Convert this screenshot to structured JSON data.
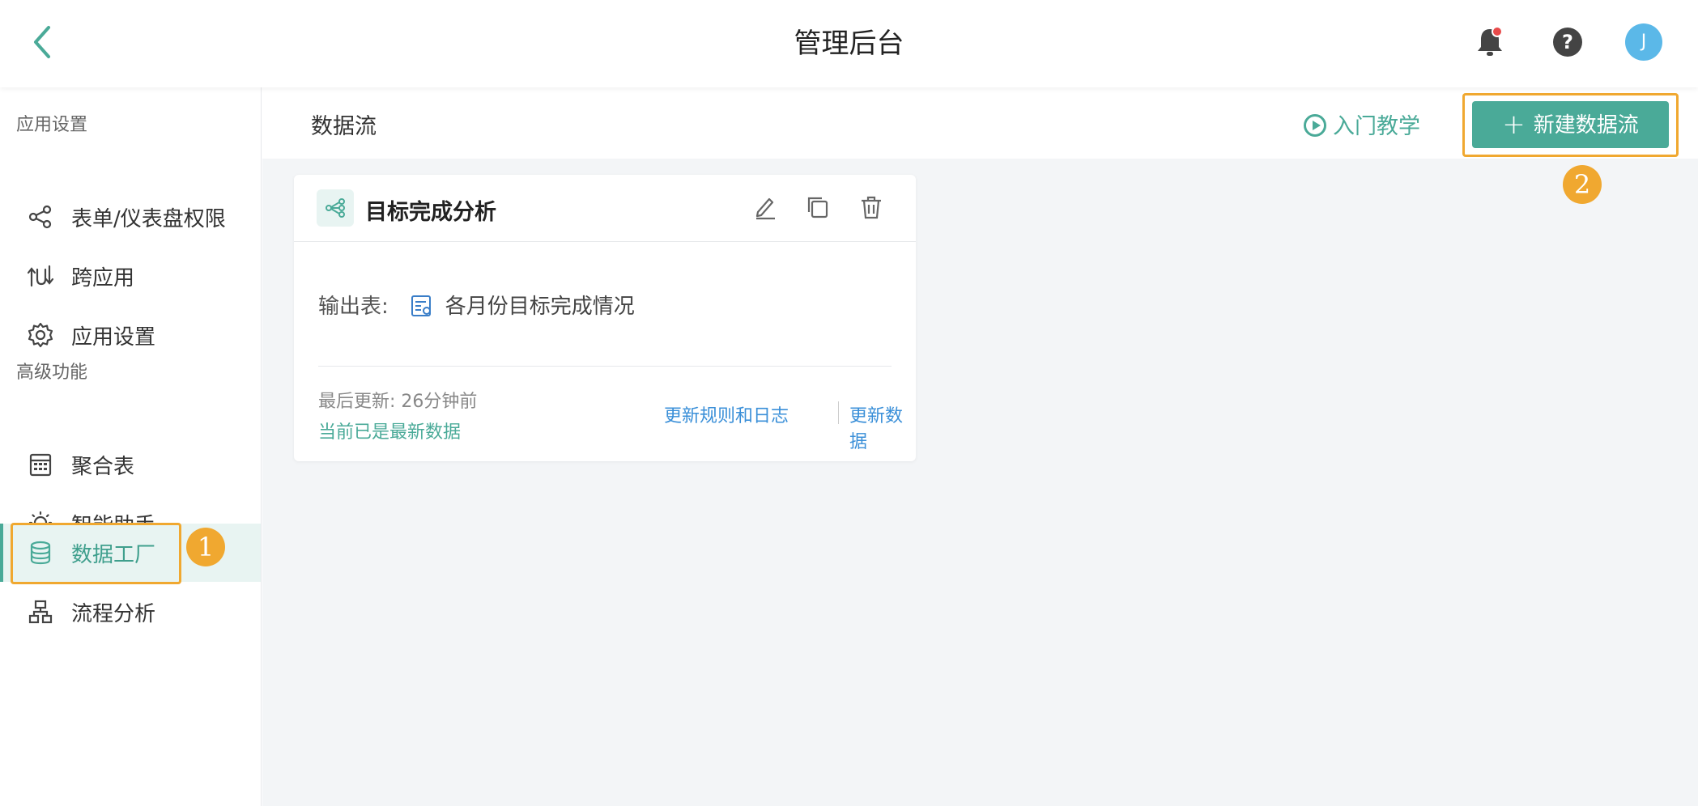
{
  "header": {
    "title": "管理后台",
    "help_label": "?",
    "avatar_initial": "J",
    "notification_dot_color": "#e84a4a"
  },
  "sidebar": {
    "section_app": "应用设置",
    "section_advanced": "高级功能",
    "items": [
      {
        "label": "表单/仪表盘权限",
        "icon": "share-icon"
      },
      {
        "label": "跨应用",
        "icon": "cross-app-icon"
      },
      {
        "label": "应用设置",
        "icon": "gear-icon"
      },
      {
        "label": "聚合表",
        "icon": "calendar-table-icon"
      },
      {
        "label": "智能助手",
        "icon": "lightbulb-icon"
      },
      {
        "label": "数据工厂",
        "icon": "database-icon",
        "active": true
      },
      {
        "label": "流程分析",
        "icon": "flowchart-icon"
      }
    ]
  },
  "annotations": {
    "badge1": "1",
    "badge2": "2",
    "highlight_color": "#f0a830"
  },
  "main": {
    "title": "数据流",
    "tutorial_label": "入门教学",
    "new_button_label": "新建数据流",
    "accent_color": "#4aaa98"
  },
  "card": {
    "title": "目标完成分析",
    "output_label": "输出表:",
    "output_table": "各月份目标完成情况",
    "last_updated": "最后更新: 26分钟前",
    "status": "当前已是最新数据",
    "rules_link": "更新规则和日志",
    "update_link": "更新数据"
  }
}
